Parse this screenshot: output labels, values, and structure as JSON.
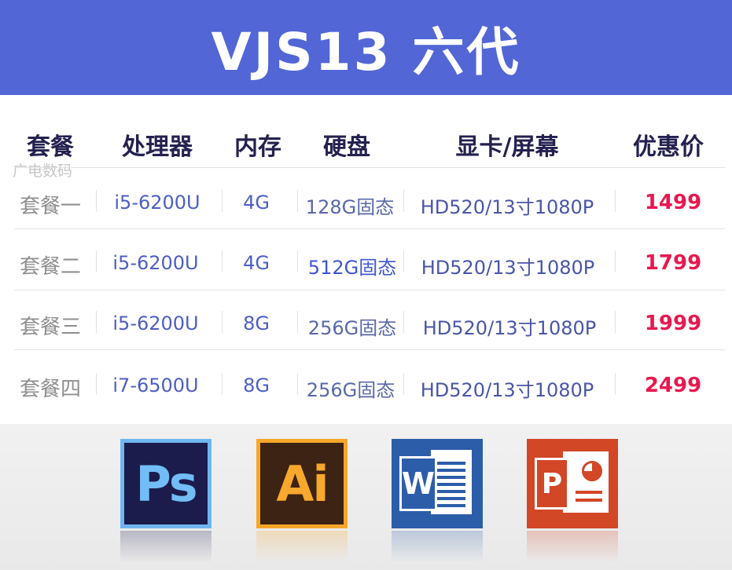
{
  "banner": {
    "title": "VJS13 六代",
    "color": "#5266d6"
  },
  "watermark": "广电数码",
  "table": {
    "headers": [
      "套餐",
      "处理器",
      "内存",
      "硬盘",
      "显卡/屏幕",
      "优惠价"
    ],
    "rows": [
      {
        "package": "套餐一",
        "cpu": "i5-6200U",
        "memory": "4G",
        "disk": "128G固态",
        "gpu_screen": "HD520/13寸1080P",
        "price": "1499"
      },
      {
        "package": "套餐二",
        "cpu": "i5-6200U",
        "memory": "4G",
        "disk": "512G固态",
        "gpu_screen": "HD520/13寸1080P",
        "price": "1799"
      },
      {
        "package": "套餐三",
        "cpu": "i5-6200U",
        "memory": "8G",
        "disk": "256G固态",
        "gpu_screen": "HD520/13寸1080P",
        "price": "1999"
      },
      {
        "package": "套餐四",
        "cpu": "i7-6500U",
        "memory": "8G",
        "disk": "256G固态",
        "gpu_screen": "HD520/13寸1080P",
        "price": "2499"
      }
    ],
    "price_color": "#e8184f"
  },
  "apps": [
    {
      "icon": "photoshop-icon",
      "label": "Ps"
    },
    {
      "icon": "illustrator-icon",
      "label": "Ai"
    },
    {
      "icon": "word-icon",
      "label": "W"
    },
    {
      "icon": "powerpoint-icon",
      "label": "P"
    }
  ]
}
